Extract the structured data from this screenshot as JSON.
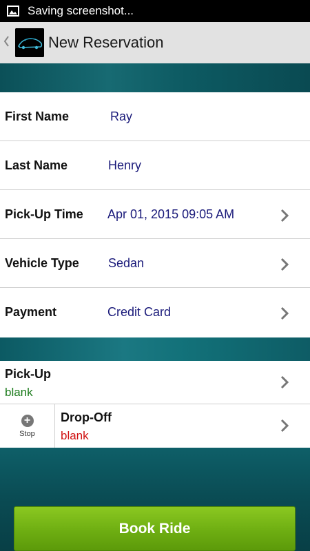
{
  "status_bar": {
    "text": "Saving screenshot...",
    "icon": "image-icon"
  },
  "action_bar": {
    "title": "New Reservation",
    "back_icon": "back-caret-icon",
    "logo": "car-logo"
  },
  "form": {
    "rows": [
      {
        "label": "First Name",
        "value": "Ray",
        "has_chevron": false
      },
      {
        "label": "Last Name",
        "value": "Henry",
        "has_chevron": false
      },
      {
        "label": "Pick-Up Time",
        "value": "Apr 01, 2015 09:05 AM",
        "has_chevron": true
      },
      {
        "label": "Vehicle Type",
        "value": "Sedan",
        "has_chevron": true
      },
      {
        "label": "Payment",
        "value": "Credit Card",
        "has_chevron": true
      }
    ]
  },
  "locations": {
    "pickup": {
      "title": "Pick-Up",
      "status": "blank",
      "status_color": "#1a7a1a"
    },
    "dropoff": {
      "title": "Drop-Off",
      "status": "blank",
      "status_color": "#d01010"
    },
    "stop": {
      "label": "Stop",
      "icon": "plus-circle-icon"
    }
  },
  "book_button": {
    "label": "Book Ride"
  },
  "colors": {
    "accent_green": "#6eae12",
    "value_blue": "#1a1a7a",
    "background_teal": "#0c4f57"
  }
}
